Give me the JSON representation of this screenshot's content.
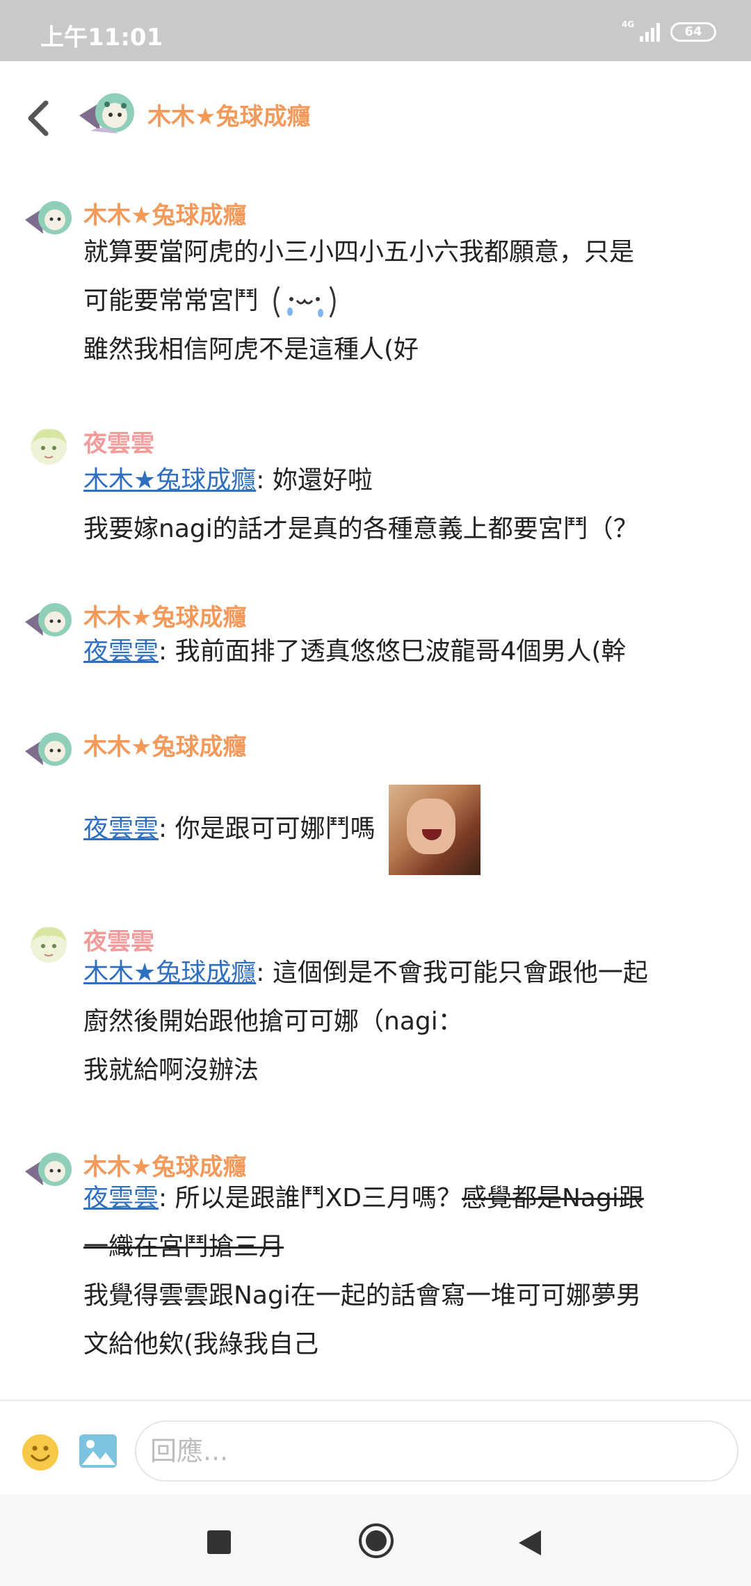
{
  "status_bar": {
    "time": "上午11:01",
    "network": "4G",
    "battery": "64"
  },
  "header": {
    "title": "木木★兔球成癮",
    "back_icon": "chevron-left-icon"
  },
  "colors": {
    "mumu_name": "#f39a5b",
    "yun_name": "#f29b9b",
    "mention": "#2f6fc0",
    "status_bar": "#c9c9c9"
  },
  "messages": [
    {
      "sender": "木木★兔球成癮",
      "lines": [
        "就算要當阿虎的小三小四小五小六我都願意，只是",
        "可能要常常宮鬥",
        "雖然我相信阿虎不是這種人(好"
      ]
    },
    {
      "sender": "夜雲雲",
      "mention": "木木★兔球成癮",
      "lines": [
        ": 妳還好啦",
        "我要嫁nagi的話才是真的各種意義上都要宮鬥（？"
      ]
    },
    {
      "sender": "木木★兔球成癮",
      "mention": "夜雲雲",
      "lines": [
        ": 我前面排了透真悠悠巳波龍哥4個男人(幹"
      ]
    },
    {
      "sender": "木木★兔球成癮",
      "mention": "夜雲雲",
      "lines": [
        ": 你是跟可可娜鬥嗎"
      ]
    },
    {
      "sender": "夜雲雲",
      "mention": "木木★兔球成癮",
      "lines": [
        ": 這個倒是不會我可能只會跟他一起",
        "廚然後開始跟他搶可可娜（nagi：",
        "我就給啊沒辦法"
      ]
    },
    {
      "sender": "木木★兔球成癮",
      "mention": "夜雲雲",
      "lines": [
        ": 所以是跟誰鬥XD三月嗎？",
        "我覺得雲雲跟Nagi在一起的話會寫一堆可可娜夢男",
        "文給他欸(我綠我自己"
      ],
      "strike_lines": [
        "感覺都是Nagi跟",
        "一織在宮鬥搶三月"
      ]
    }
  ],
  "input": {
    "placeholder": "回應..."
  }
}
